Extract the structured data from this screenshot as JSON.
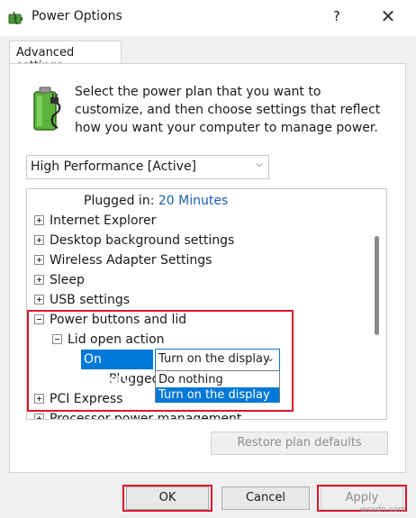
{
  "window": {
    "title": "Power Options",
    "help": "?",
    "close": "✕"
  },
  "tab": {
    "label": "Advanced settings"
  },
  "description": "Select the power plan that you want to customize, and then choose settings that reflect how you want your computer to manage power.",
  "plan_select": {
    "value": "High Performance [Active]"
  },
  "tree": {
    "plugged_in_top": {
      "label": "Plugged in:",
      "value": "20 Minutes"
    },
    "items": [
      "Internet Explorer",
      "Desktop background settings",
      "Wireless Adapter Settings",
      "Sleep",
      "USB settings"
    ],
    "power_buttons": "Power buttons and lid",
    "lid_open_action": "Lid open action",
    "on_battery": {
      "label": "On battery:",
      "value": "Turn on the display"
    },
    "plugged_in": {
      "label": "Plugged in:"
    },
    "options": [
      "Do nothing",
      "Turn on the display"
    ],
    "pci_express": "PCI Express",
    "processor": "Processor power management"
  },
  "buttons": {
    "restore": "Restore plan defaults",
    "ok": "OK",
    "cancel": "Cancel",
    "apply": "Apply"
  },
  "watermark": "wsxdn.com",
  "colors": {
    "accent": "#0078d7",
    "highlight_red": "#d9182e",
    "link": "#1a5fb4"
  }
}
